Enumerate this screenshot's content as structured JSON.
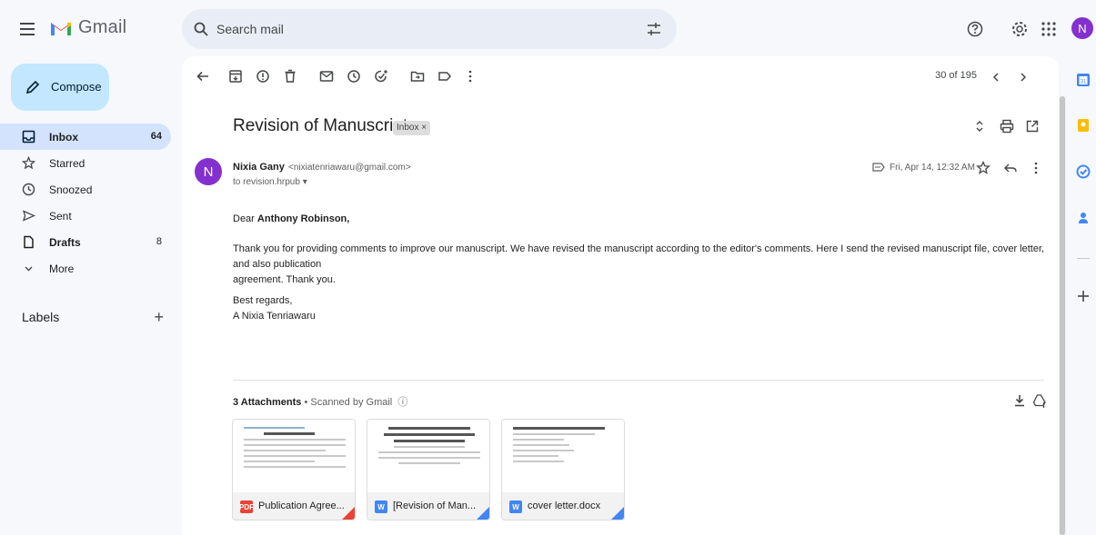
{
  "app": {
    "name": "Gmail"
  },
  "search": {
    "placeholder": "Search mail"
  },
  "compose": {
    "label": "Compose"
  },
  "nav": {
    "items": [
      {
        "label": "Inbox",
        "count": "64"
      },
      {
        "label": "Starred",
        "count": ""
      },
      {
        "label": "Snoozed",
        "count": ""
      },
      {
        "label": "Sent",
        "count": ""
      },
      {
        "label": "Drafts",
        "count": "8"
      },
      {
        "label": "More",
        "count": ""
      }
    ],
    "labels_heading": "Labels"
  },
  "toolbar": {
    "pager": "30 of 195"
  },
  "email": {
    "subject": "Revision of Manuscript",
    "chip": "Inbox ×",
    "sender_name": "Nixia Gany",
    "sender_email": "<nixiatenriawaru@gmail.com>",
    "to": "to revision.hrpub ▾",
    "date": "Fri, Apr 14, 12:32 AM",
    "avatar_letter": "N",
    "greeting_prefix": "Dear ",
    "greeting_name": "Anthony Robinson,",
    "body_line1": "Thank you for providing comments to improve our manuscript. We have revised the manuscript according to the editor's comments. Here I send the revised manuscript file, cover letter, and also publication",
    "body_line2": "agreement. Thank you.",
    "closing": "Best regards,",
    "signature": "A Nixia Tenriawaru"
  },
  "attachments": {
    "count_label": "3 Attachments",
    "separator": " • ",
    "scanned": "Scanned by Gmail",
    "files": [
      {
        "name": "Publication Agree...",
        "type": "PDF",
        "color": "#ea4335"
      },
      {
        "name": "[Revision of Man...",
        "type": "W",
        "color": "#4285f4"
      },
      {
        "name": "cover letter.docx",
        "type": "W",
        "color": "#4285f4"
      }
    ]
  },
  "account": {
    "avatar_letter": "N"
  },
  "colors": {
    "accent": "#c2e7ff",
    "active_nav": "#d3e3fd",
    "avatar": "#8430ce"
  }
}
